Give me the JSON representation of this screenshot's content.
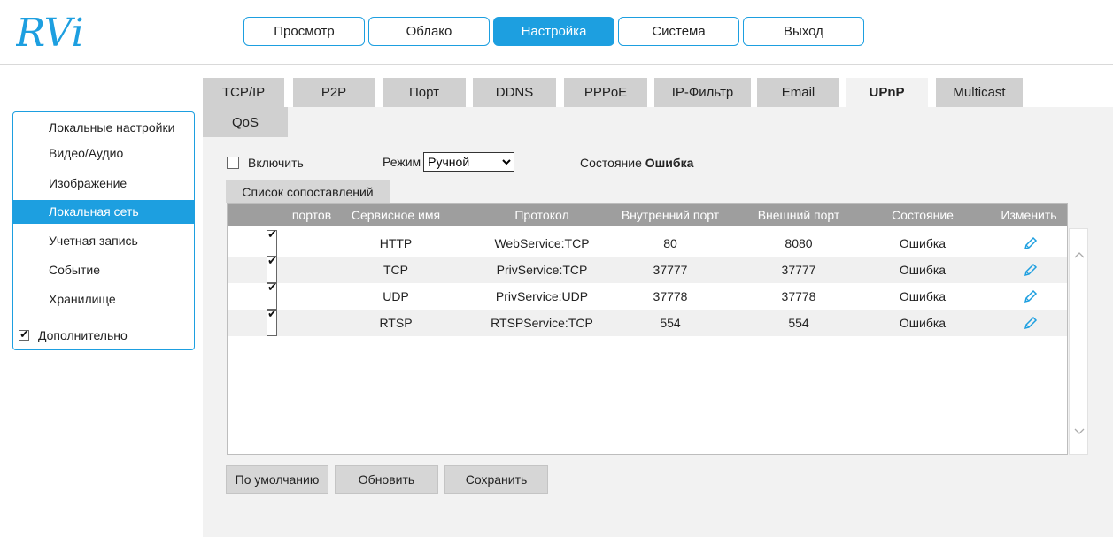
{
  "logo": {
    "text": "RVi",
    "color": "#1d9fe0"
  },
  "topnav": [
    "Просмотр",
    "Облако",
    "Настройка",
    "Система",
    "Выход"
  ],
  "sidebar": {
    "items": [
      "Локальные настройки",
      "Видео/Аудио",
      "Изображение",
      "Локальная сеть",
      "Учетная запись",
      "Событие",
      "Хранилище"
    ],
    "advanced": "Дополнительно",
    "active": "Локальная сеть"
  },
  "tabs": [
    "TCP/IP",
    "P2P",
    "Порт",
    "DDNS",
    "PPPoE",
    "IP-Фильтр",
    "Email",
    "UPnP",
    "Multicast",
    "QoS"
  ],
  "active_tab": "UPnP",
  "form": {
    "enable_label": "Включить",
    "mode_label": "Режим",
    "mode_value": "Ручной",
    "status_label": "Состояние",
    "status_value": "Ошибка"
  },
  "mapping_tab": "Список сопоставлений",
  "table": {
    "columns": [
      "портов",
      "Сервисное имя",
      "Протокол",
      "Внутренний порт",
      "Внешний порт",
      "Состояние",
      "Изменить"
    ],
    "rows": [
      {
        "service": "HTTP",
        "protocol": "WebService:TCP",
        "internal": "80",
        "external": "8080",
        "status": "Ошибка"
      },
      {
        "service": "TCP",
        "protocol": "PrivService:TCP",
        "internal": "37777",
        "external": "37777",
        "status": "Ошибка"
      },
      {
        "service": "UDP",
        "protocol": "PrivService:UDP",
        "internal": "37778",
        "external": "37778",
        "status": "Ошибка"
      },
      {
        "service": "RTSP",
        "protocol": "RTSPService:TCP",
        "internal": "554",
        "external": "554",
        "status": "Ошибка"
      }
    ]
  },
  "buttons": {
    "default": "По умолчанию",
    "refresh": "Обновить",
    "save": "Сохранить"
  },
  "icons": {
    "edit": "pencil-icon",
    "scroll_up": "chevron-up-icon",
    "scroll_down": "chevron-down-icon"
  },
  "colors": {
    "accent": "#1d9fe0",
    "tab_inactive": "#d0d0d0",
    "header_bg": "#9e9e9e"
  }
}
